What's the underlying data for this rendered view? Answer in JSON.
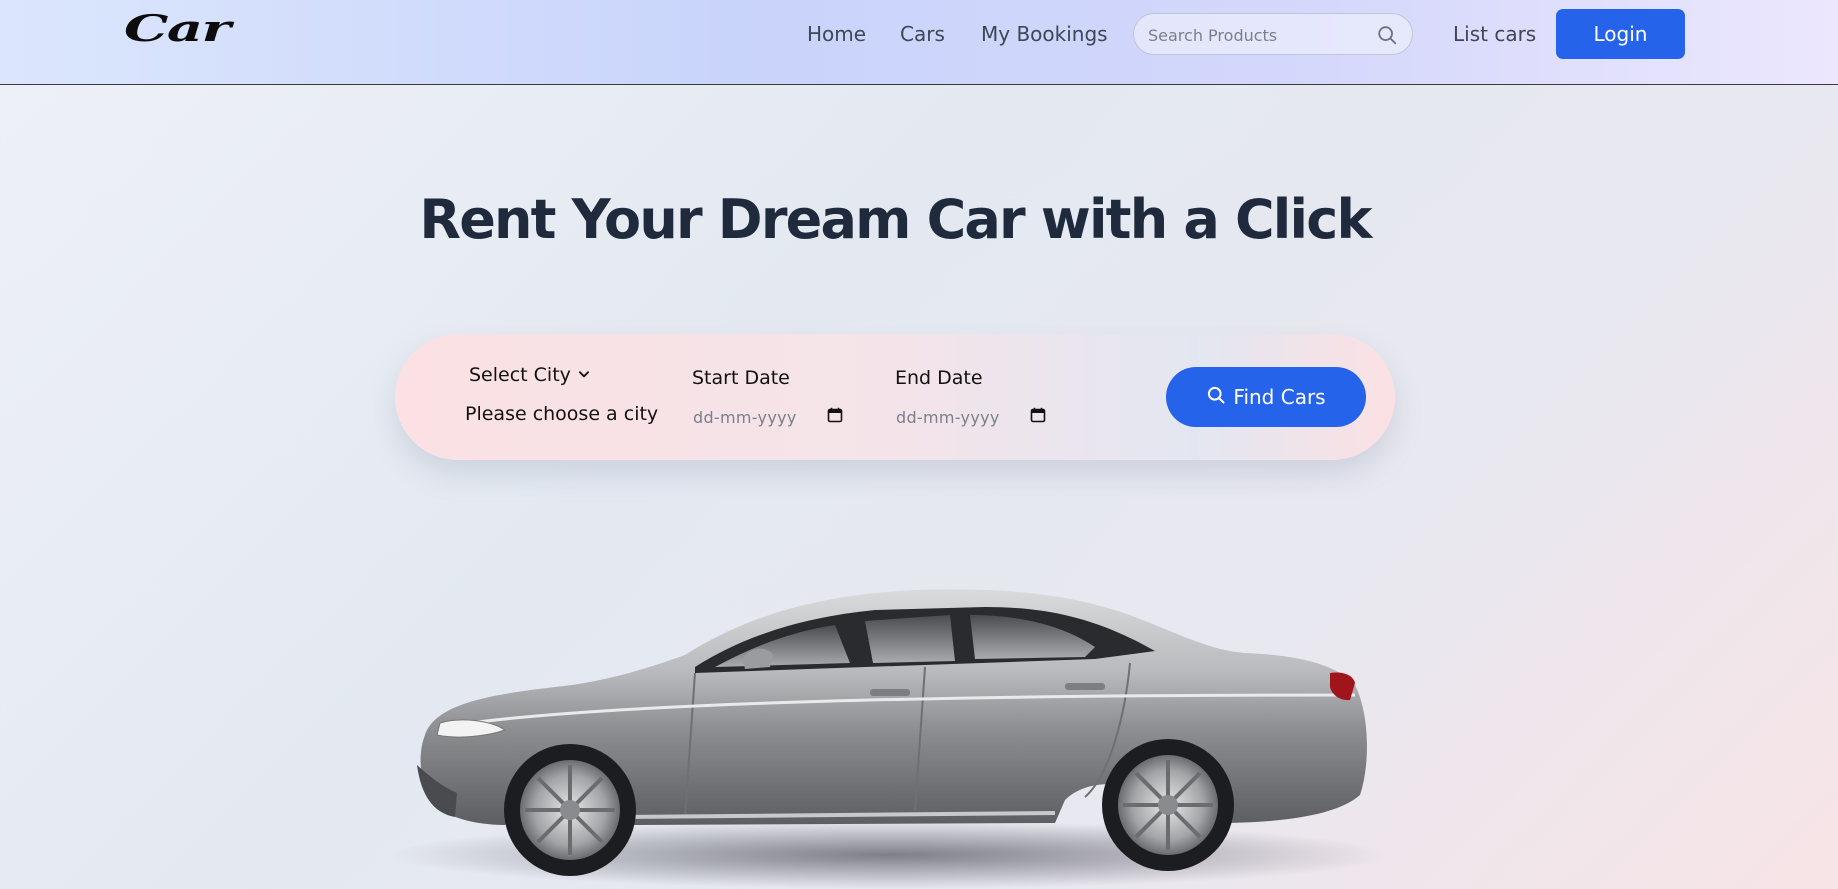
{
  "nav": {
    "logo": "Car",
    "links": [
      "Home",
      "Cars",
      "My Bookings"
    ],
    "search_placeholder": "Search Products",
    "list_cars": "List cars",
    "login": "Login"
  },
  "hero": {
    "title": "Rent Your Dream Car with a Click"
  },
  "booking": {
    "city_label": "Select City",
    "city_hint": "Please choose a city",
    "start_label": "Start Date",
    "end_label": "End Date",
    "date_placeholder": "dd-mm-yyyy",
    "find_button": "Find Cars"
  },
  "colors": {
    "accent": "#2563eb",
    "title": "#1f2a3d"
  },
  "icons": [
    "search-icon",
    "chevron-down-icon",
    "calendar-icon"
  ]
}
